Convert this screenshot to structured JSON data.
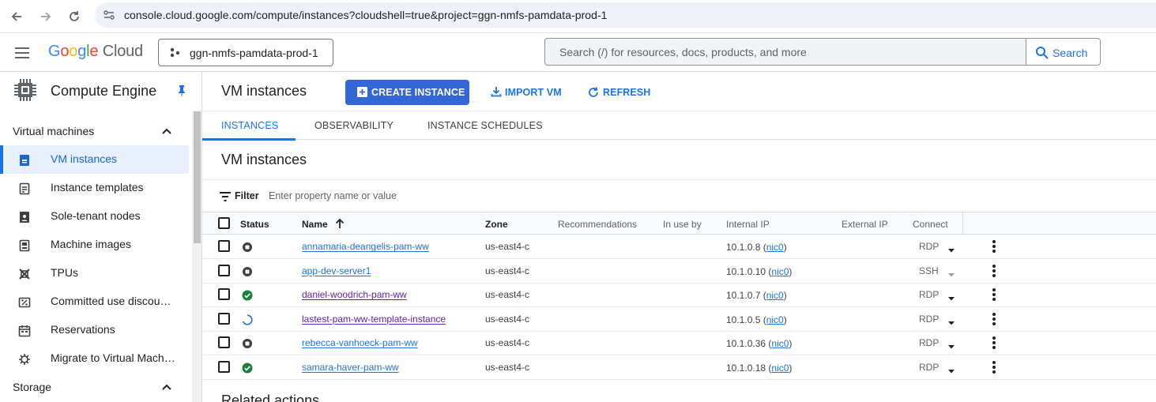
{
  "browser": {
    "url": "console.cloud.google.com/compute/instances?cloudshell=true&project=ggn-nmfs-pamdata-prod-1",
    "icons": [
      "back-arrow-icon",
      "forward-arrow-icon",
      "reload-icon",
      "site-info-icon"
    ]
  },
  "header": {
    "logo_google": [
      "G",
      "o",
      "o",
      "g",
      "l",
      "e"
    ],
    "logo_cloud": "Cloud",
    "project": "ggn-nmfs-pamdata-prod-1",
    "search_placeholder": "Search (/) for resources, docs, products, and more",
    "search_button": "Search"
  },
  "sidebar": {
    "product": "Compute Engine",
    "section1": "Virtual machines",
    "items": [
      {
        "label": "VM instances",
        "icon": "vm-instance-icon",
        "active": true
      },
      {
        "label": "Instance templates",
        "icon": "instance-template-icon"
      },
      {
        "label": "Sole-tenant nodes",
        "icon": "sole-tenant-icon"
      },
      {
        "label": "Machine images",
        "icon": "machine-image-icon"
      },
      {
        "label": "TPUs",
        "icon": "tpu-icon"
      },
      {
        "label": "Committed use discou…",
        "icon": "discount-icon"
      },
      {
        "label": "Reservations",
        "icon": "calendar-icon"
      },
      {
        "label": "Migrate to Virtual Mach…",
        "icon": "migrate-icon"
      }
    ],
    "section2": "Storage"
  },
  "main": {
    "title": "VM instances",
    "create_btn": "CREATE INSTANCE",
    "import_btn": "IMPORT VM",
    "refresh_btn": "REFRESH",
    "tabs": [
      "INSTANCES",
      "OBSERVABILITY",
      "INSTANCE SCHEDULES"
    ],
    "section_title": "VM instances",
    "filter_label": "Filter",
    "filter_placeholder": "Enter property name or value",
    "columns": [
      "Status",
      "Name",
      "Zone",
      "Recommendations",
      "In use by",
      "Internal IP",
      "External IP",
      "Connect"
    ],
    "related": "Related actions"
  },
  "instances": [
    {
      "status": "stopped",
      "name": "annamaria-deangelis-pam-ww",
      "zone": "us-east4-c",
      "ip": "10.1.0.8",
      "nic": "nic0",
      "connect": "RDP",
      "visited": false
    },
    {
      "status": "stopped",
      "name": "app-dev-server1",
      "zone": "us-east4-c",
      "ip": "10.1.0.10",
      "nic": "nic0",
      "connect": "SSH",
      "visited": false
    },
    {
      "status": "running",
      "name": "daniel-woodrich-pam-ww",
      "zone": "us-east4-c",
      "ip": "10.1.0.7",
      "nic": "nic0",
      "connect": "RDP",
      "visited": true
    },
    {
      "status": "starting",
      "name": "lastest-pam-ww-template-instance",
      "zone": "us-east4-c",
      "ip": "10.1.0.5",
      "nic": "nic0",
      "connect": "RDP",
      "visited": true
    },
    {
      "status": "stopped",
      "name": "rebecca-vanhoeck-pam-ww",
      "zone": "us-east4-c",
      "ip": "10.1.0.36",
      "nic": "nic0",
      "connect": "RDP",
      "visited": false
    },
    {
      "status": "running",
      "name": "samara-haver-pam-ww",
      "zone": "us-east4-c",
      "ip": "10.1.0.18",
      "nic": "nic0",
      "connect": "RDP",
      "visited": false
    }
  ],
  "colors": {
    "accent": "#1a73e8",
    "running": "#188038",
    "stopped": "#5f6368",
    "visited": "#681da8"
  }
}
